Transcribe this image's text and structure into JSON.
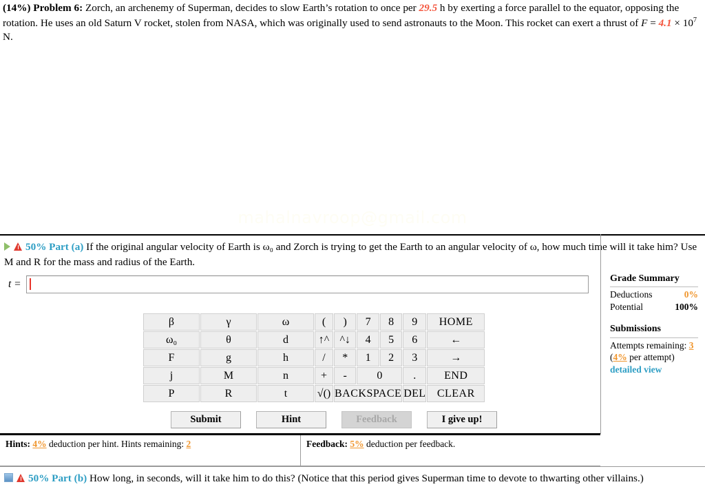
{
  "problem": {
    "percent": "(14%)",
    "label": "Problem 6:",
    "text_1": "Zorch, an archenemy of Superman, decides to slow Earth’s rotation to once per",
    "period_value": "29.5",
    "text_2": "h by exerting a force parallel to the equator, opposing the rotation. He uses an old Saturn V rocket, stolen from NASA, which was originally used to send astronauts to the Moon. This rocket can exert a thrust of",
    "force_symbol": "F",
    "equals": "=",
    "force_value": "4.1",
    "force_times": "× 10",
    "force_exponent": "7",
    "force_unit": "N."
  },
  "watermark": "mahalnavroop@gmail.com",
  "part_a": {
    "percent": "50%",
    "name": "Part (a)",
    "text": "If the original angular velocity of Earth is ω₀ and Zorch is trying to get the Earth to an angular velocity of ω, how much time will it take him? Use M and R for the mass and radius of the Earth.",
    "answer_label": "t =",
    "answer_value": "",
    "answer_placeholder": ""
  },
  "part_b": {
    "percent": "50%",
    "name": "Part (b)",
    "text": "How long, in seconds, will it take him to do this? (Notice that this period gives Superman time to devote to thwarting other villains.)"
  },
  "keypad": {
    "rows": [
      [
        {
          "label": "β",
          "type": "sym",
          "disabled": false
        },
        {
          "label": "γ",
          "type": "sym",
          "disabled": false
        },
        {
          "label": "ω",
          "type": "sym",
          "disabled": false
        },
        {
          "label": "(",
          "type": "paren",
          "disabled": false
        },
        {
          "label": ")",
          "type": "paren",
          "disabled": true
        },
        {
          "label": "7",
          "type": "num",
          "disabled": false
        },
        {
          "label": "8",
          "type": "num",
          "disabled": false
        },
        {
          "label": "9",
          "type": "num",
          "disabled": false
        },
        {
          "label": "HOME",
          "type": "wide-small",
          "disabled": true
        }
      ],
      [
        {
          "label": "ω₀",
          "type": "sym",
          "disabled": false
        },
        {
          "label": "θ",
          "type": "sym",
          "disabled": false
        },
        {
          "label": "d",
          "type": "sym",
          "disabled": false
        },
        {
          "label": "↑^",
          "type": "arrow",
          "disabled": true
        },
        {
          "label": "^↓",
          "type": "arrow",
          "disabled": true
        },
        {
          "label": "4",
          "type": "num",
          "disabled": false
        },
        {
          "label": "5",
          "type": "num",
          "disabled": false
        },
        {
          "label": "6",
          "type": "num",
          "disabled": false
        },
        {
          "label": "←",
          "type": "wide-arrow",
          "disabled": true
        }
      ],
      [
        {
          "label": "F",
          "type": "sym",
          "disabled": false
        },
        {
          "label": "g",
          "type": "sym",
          "disabled": false
        },
        {
          "label": "h",
          "type": "sym",
          "disabled": false
        },
        {
          "label": "/",
          "type": "paren",
          "disabled": true
        },
        {
          "label": "*",
          "type": "paren",
          "disabled": true
        },
        {
          "label": "1",
          "type": "num",
          "disabled": false
        },
        {
          "label": "2",
          "type": "num",
          "disabled": false
        },
        {
          "label": "3",
          "type": "num",
          "disabled": false
        },
        {
          "label": "→",
          "type": "wide-arrow",
          "disabled": true
        }
      ],
      [
        {
          "label": "j",
          "type": "sym",
          "disabled": false
        },
        {
          "label": "M",
          "type": "sym",
          "disabled": false
        },
        {
          "label": "n",
          "type": "sym",
          "disabled": false
        },
        {
          "label": "+",
          "type": "paren",
          "disabled": false
        },
        {
          "label": "-",
          "type": "paren",
          "disabled": false
        },
        {
          "label": "0",
          "type": "num2",
          "disabled": false
        },
        {
          "label": ".",
          "type": "num",
          "disabled": false
        },
        {
          "label": "END",
          "type": "wide-small",
          "disabled": true
        }
      ],
      [
        {
          "label": "P",
          "type": "sym",
          "disabled": false
        },
        {
          "label": "R",
          "type": "sym",
          "disabled": false
        },
        {
          "label": "t",
          "type": "sym",
          "disabled": false
        },
        {
          "label": "√()",
          "type": "paren",
          "disabled": false
        },
        {
          "label": "BACKSPACE",
          "type": "backspace",
          "disabled": true
        },
        {
          "label": "DEL",
          "type": "del",
          "disabled": true
        },
        {
          "label": "CLEAR",
          "type": "wide-small",
          "disabled": true
        }
      ]
    ]
  },
  "buttons": {
    "submit": "Submit",
    "hint": "Hint",
    "feedback": "Feedback",
    "give_up": "I give up!"
  },
  "hints_strip": {
    "hints_label": "Hints:",
    "hints_deduction": "4%",
    "hints_text": "deduction per hint. Hints remaining:",
    "hints_remaining": "2",
    "feedback_label": "Feedback:",
    "feedback_deduction": "5%",
    "feedback_text": "deduction per feedback."
  },
  "grade_summary": {
    "title": "Grade Summary",
    "deductions_label": "Deductions",
    "deductions_value": "0%",
    "potential_label": "Potential",
    "potential_value": "100%",
    "submissions_title": "Submissions",
    "attempts_label": "Attempts remaining:",
    "attempts_value": "3",
    "per_attempt_open": "(",
    "per_attempt_value": "4%",
    "per_attempt_text": "per attempt)",
    "detailed_view": "detailed view"
  }
}
